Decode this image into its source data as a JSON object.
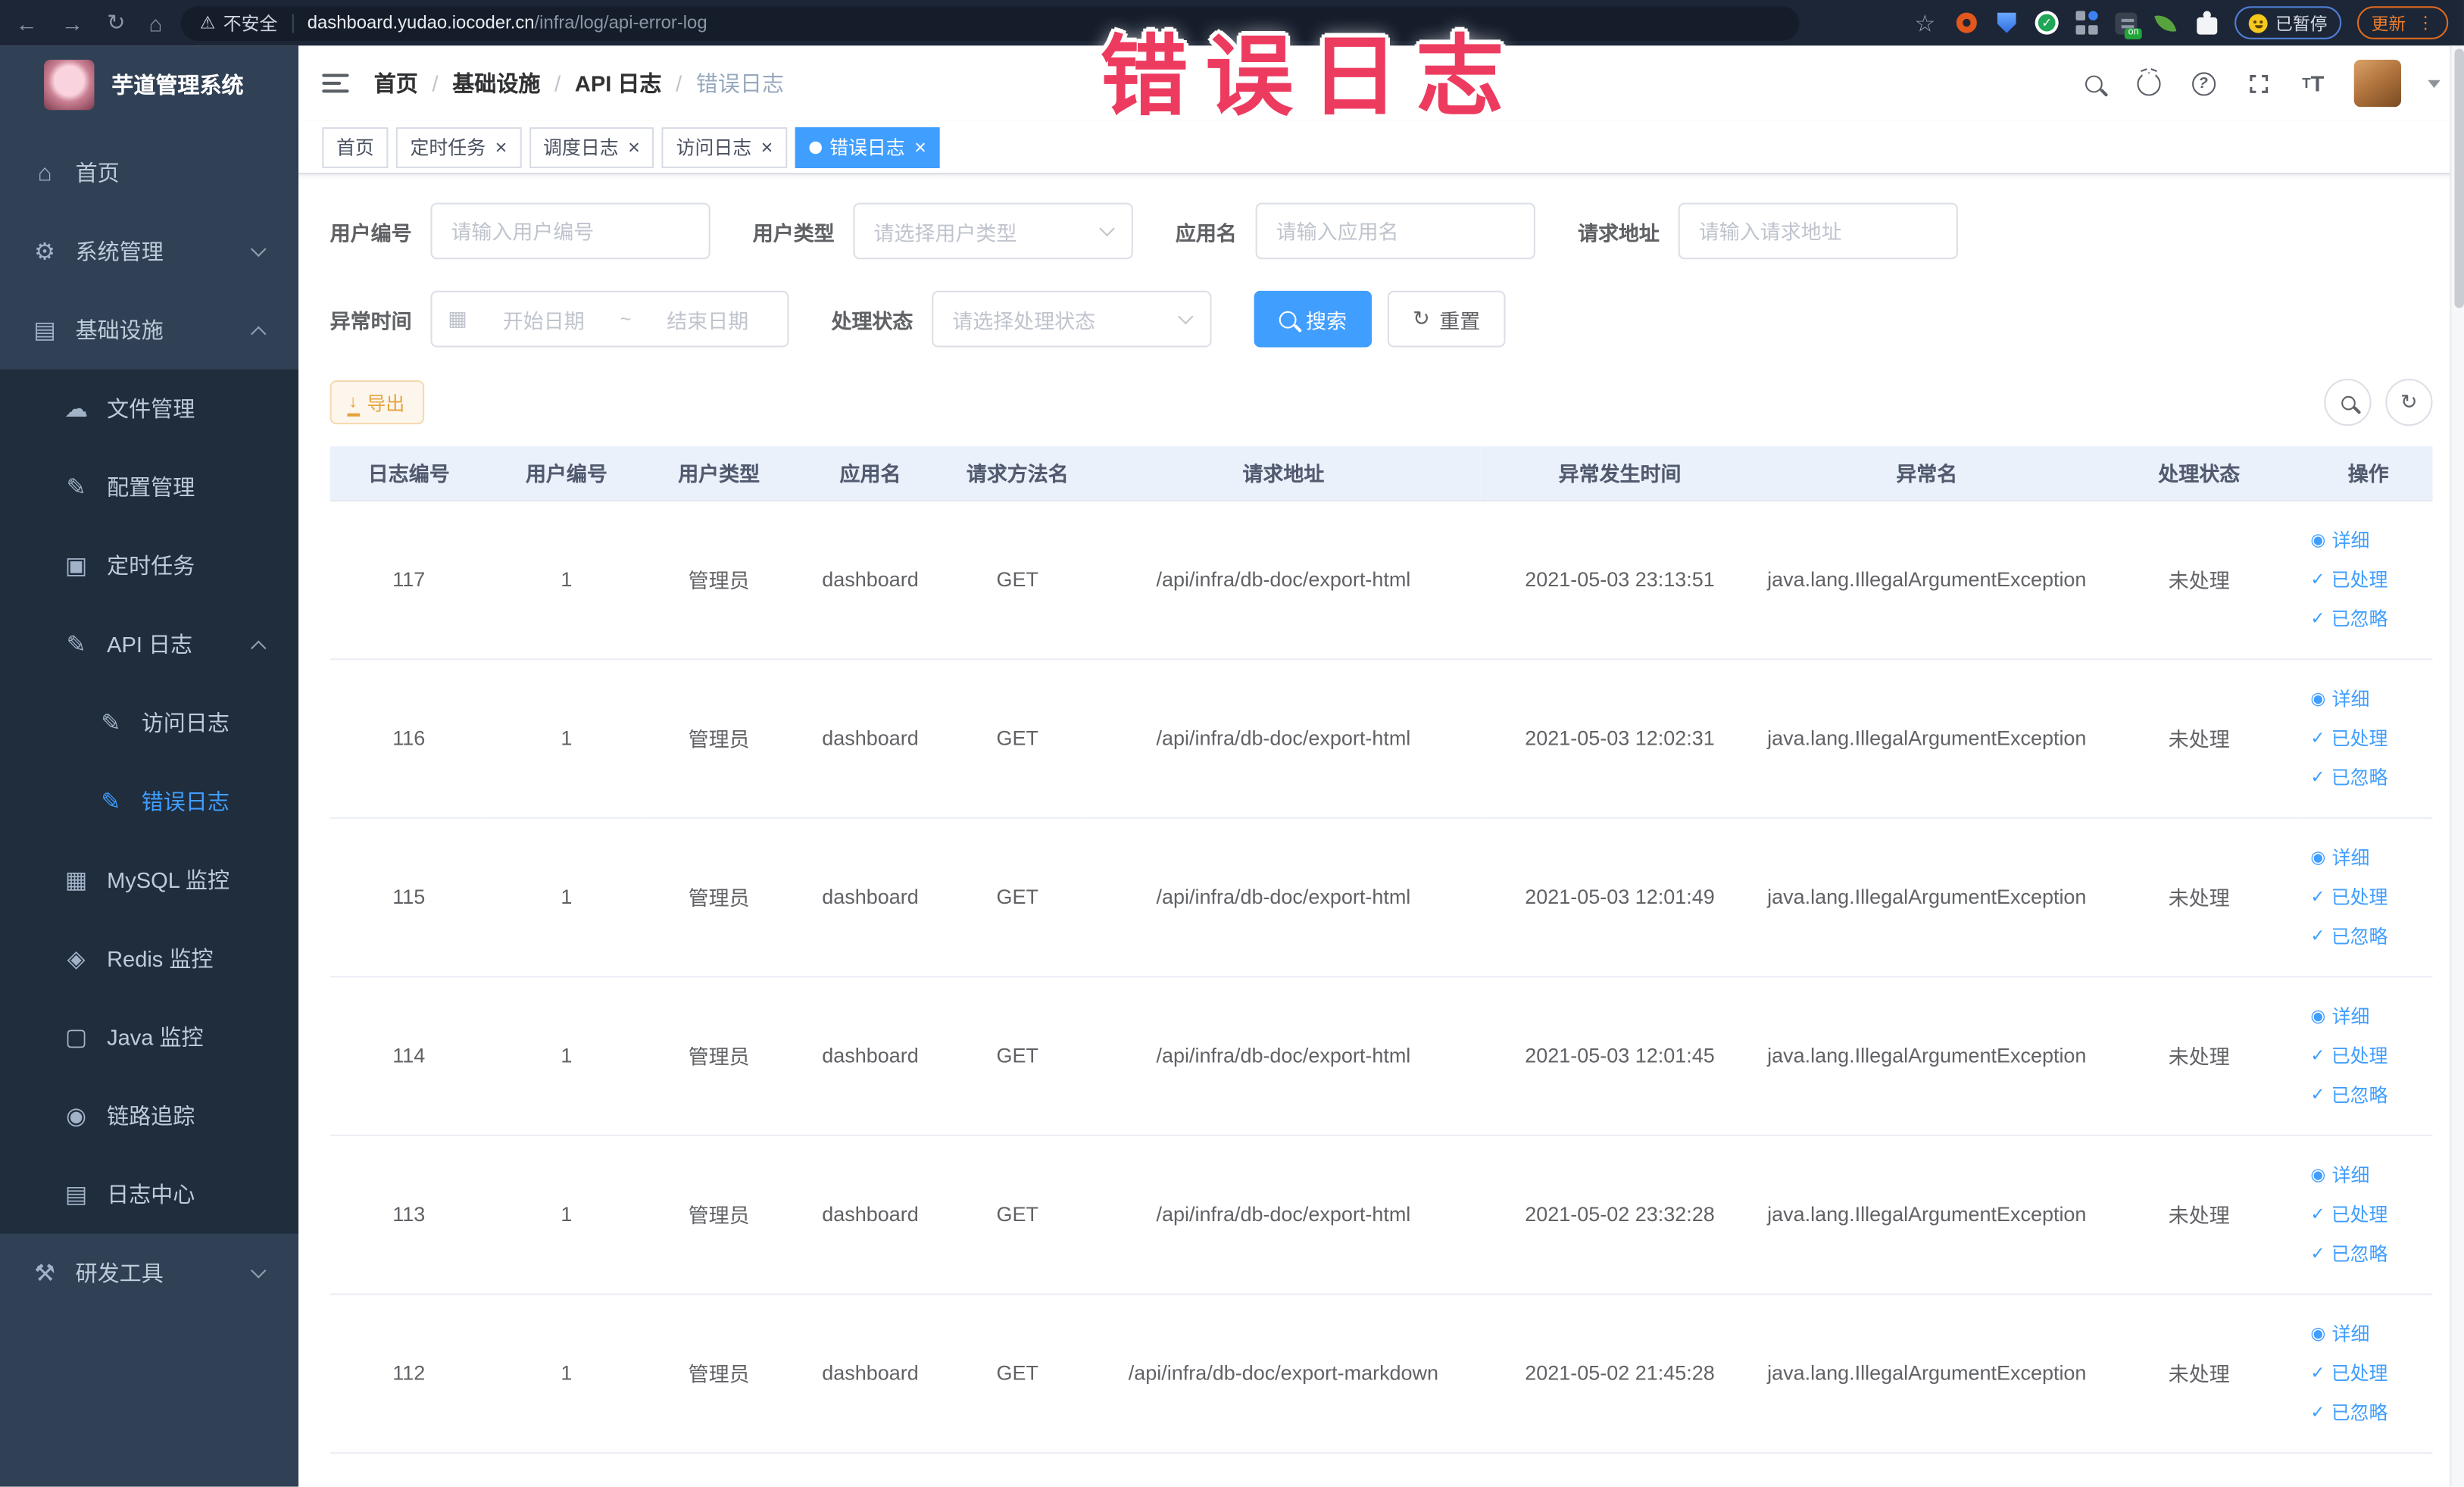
{
  "browser": {
    "security_label": "不安全",
    "url_domain": "dashboard.yudao.iocoder.cn",
    "url_path": "/infra/log/api-error-log",
    "paused_badge": "已暂停",
    "update_button": "更新"
  },
  "sidebar": {
    "title": "芋道管理系统",
    "items": [
      {
        "label": "首页",
        "icon": "home-icon",
        "level": 1
      },
      {
        "label": "系统管理",
        "icon": "gear-icon",
        "level": 1,
        "chevron": "down"
      },
      {
        "label": "基础设施",
        "icon": "infra-icon",
        "level": 1,
        "chevron": "up"
      },
      {
        "label": "文件管理",
        "icon": "file-manage-icon",
        "level": 2,
        "block": true
      },
      {
        "label": "配置管理",
        "icon": "config-manage-icon",
        "level": 2,
        "block": true
      },
      {
        "label": "定时任务",
        "icon": "scheduled-job-icon",
        "level": 2,
        "block": true
      },
      {
        "label": "API 日志",
        "icon": "api-log-icon",
        "level": 2,
        "block": true,
        "chevron": "up"
      },
      {
        "label": "访问日志",
        "icon": "access-log-icon",
        "level": 3,
        "block": true
      },
      {
        "label": "错误日志",
        "icon": "error-log-icon",
        "level": 3,
        "block": true,
        "active": true
      },
      {
        "label": "MySQL 监控",
        "icon": "mysql-monitor-icon",
        "level": 2,
        "block": true
      },
      {
        "label": "Redis 监控",
        "icon": "redis-monitor-icon",
        "level": 2,
        "block": true
      },
      {
        "label": "Java 监控",
        "icon": "java-monitor-icon",
        "level": 2,
        "block": true
      },
      {
        "label": "链路追踪",
        "icon": "trace-icon",
        "level": 2,
        "block": true
      },
      {
        "label": "日志中心",
        "icon": "log-center-icon",
        "level": 2,
        "block": true
      },
      {
        "label": "研发工具",
        "icon": "dev-tools-icon",
        "level": 1,
        "chevron": "down"
      }
    ]
  },
  "navbar": {
    "breadcrumb": [
      "首页",
      "基础设施",
      "API 日志",
      "错误日志"
    ]
  },
  "tabs": [
    {
      "label": "首页",
      "closable": false,
      "active": false
    },
    {
      "label": "定时任务",
      "closable": true,
      "active": false
    },
    {
      "label": "调度日志",
      "closable": true,
      "active": false
    },
    {
      "label": "访问日志",
      "closable": true,
      "active": false
    },
    {
      "label": "错误日志",
      "closable": true,
      "active": true
    }
  ],
  "annotation": "错误日志",
  "filters": {
    "user_id": {
      "label": "用户编号",
      "placeholder": "请输入用户编号"
    },
    "user_type": {
      "label": "用户类型",
      "placeholder": "请选择用户类型"
    },
    "app_name": {
      "label": "应用名",
      "placeholder": "请输入应用名"
    },
    "request_url": {
      "label": "请求地址",
      "placeholder": "请输入请求地址"
    },
    "exception_time": {
      "label": "异常时间",
      "start_placeholder": "开始日期",
      "separator": "~",
      "end_placeholder": "结束日期"
    },
    "process_status": {
      "label": "处理状态",
      "placeholder": "请选择处理状态"
    },
    "search_button": "搜索",
    "reset_button": "重置"
  },
  "toolbar": {
    "export_button": "导出"
  },
  "table": {
    "columns": [
      "日志编号",
      "用户编号",
      "用户类型",
      "应用名",
      "请求方法名",
      "请求地址",
      "异常发生时间",
      "异常名",
      "处理状态",
      "操作"
    ],
    "row_actions": [
      {
        "icon": "eye-icon",
        "label": "详细"
      },
      {
        "icon": "check-icon",
        "label": "已处理"
      },
      {
        "icon": "check-icon",
        "label": "已忽略"
      }
    ],
    "rows": [
      {
        "id": "117",
        "user_id": "1",
        "user_type": "管理员",
        "app": "dashboard",
        "method": "GET",
        "url": "/api/infra/db-doc/export-html",
        "time": "2021-05-03 23:13:51",
        "exception": "java.lang.IllegalArgumentException",
        "status": "未处理"
      },
      {
        "id": "116",
        "user_id": "1",
        "user_type": "管理员",
        "app": "dashboard",
        "method": "GET",
        "url": "/api/infra/db-doc/export-html",
        "time": "2021-05-03 12:02:31",
        "exception": "java.lang.IllegalArgumentException",
        "status": "未处理"
      },
      {
        "id": "115",
        "user_id": "1",
        "user_type": "管理员",
        "app": "dashboard",
        "method": "GET",
        "url": "/api/infra/db-doc/export-html",
        "time": "2021-05-03 12:01:49",
        "exception": "java.lang.IllegalArgumentException",
        "status": "未处理"
      },
      {
        "id": "114",
        "user_id": "1",
        "user_type": "管理员",
        "app": "dashboard",
        "method": "GET",
        "url": "/api/infra/db-doc/export-html",
        "time": "2021-05-03 12:01:45",
        "exception": "java.lang.IllegalArgumentException",
        "status": "未处理"
      },
      {
        "id": "113",
        "user_id": "1",
        "user_type": "管理员",
        "app": "dashboard",
        "method": "GET",
        "url": "/api/infra/db-doc/export-html",
        "time": "2021-05-02 23:32:28",
        "exception": "java.lang.IllegalArgumentException",
        "status": "未处理"
      },
      {
        "id": "112",
        "user_id": "1",
        "user_type": "管理员",
        "app": "dashboard",
        "method": "GET",
        "url": "/api/infra/db-doc/export-markdown",
        "time": "2021-05-02 21:45:28",
        "exception": "java.lang.IllegalArgumentException",
        "status": "未处理"
      }
    ]
  },
  "colors": {
    "accent": "#409eff",
    "sidebar_bg": "#304156",
    "submenu_bg": "#1f2d3d",
    "annotation_red": "#ed3b5f",
    "warning_orange": "#e6a23c",
    "table_header_bg": "#eaf1fb"
  }
}
